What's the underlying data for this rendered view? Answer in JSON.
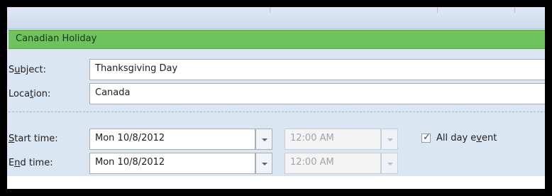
{
  "banner": {
    "label": "Canadian Holiday",
    "color": "#6fc25e"
  },
  "fields": {
    "subject": {
      "label_pre": "S",
      "label_key": "u",
      "label_post": "bject:",
      "value": "Thanksgiving Day"
    },
    "location": {
      "label_pre": "Loca",
      "label_key": "t",
      "label_post": "ion:",
      "value": "Canada"
    }
  },
  "start": {
    "label_pre": "",
    "label_key": "S",
    "label_post": "tart time:",
    "date": "Mon 10/8/2012",
    "time": "12:00 AM"
  },
  "end": {
    "label_pre": "E",
    "label_key": "n",
    "label_post": "d time:",
    "date": "Mon 10/8/2012",
    "time": "12:00 AM"
  },
  "all_day": {
    "checked": true,
    "check_glyph": "✓",
    "label_pre": "All day e",
    "label_key": "v",
    "label_post": "ent"
  }
}
